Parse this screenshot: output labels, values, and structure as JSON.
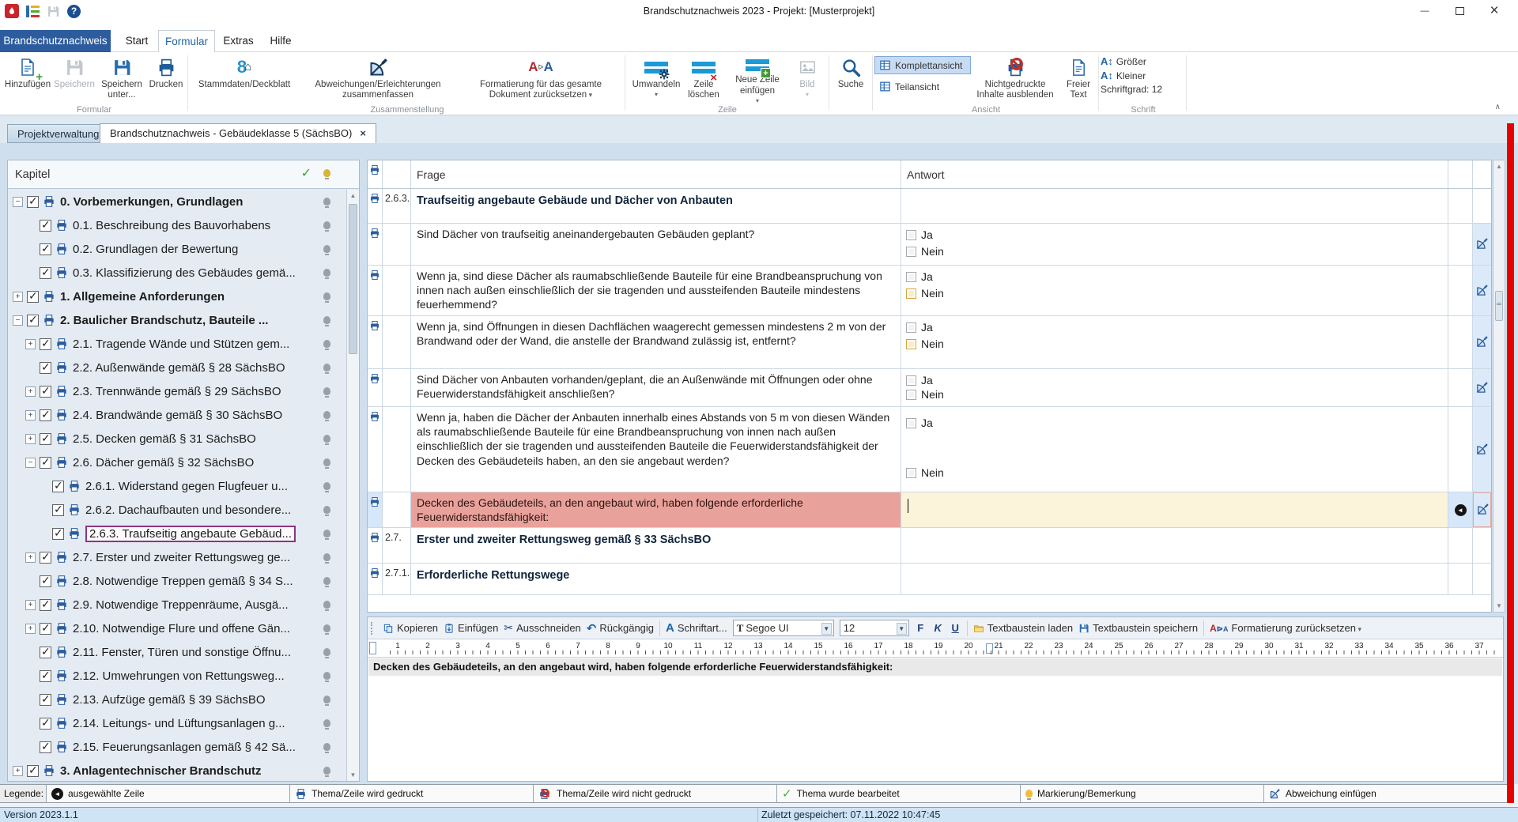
{
  "titlebar": {
    "title": "Brandschutznachweis 2023 - Projekt: [Musterprojekt]"
  },
  "menu": {
    "app_button": "Brandschutznachweis",
    "tabs": [
      "Start",
      "Formular",
      "Extras",
      "Hilfe"
    ],
    "active_tab": "Formular"
  },
  "ribbon": {
    "formular": {
      "label": "Formular",
      "add": "Hinzufügen",
      "save": "Speichern",
      "save_as": "Speichern unter...",
      "print": "Drucken"
    },
    "zusammenstellung": {
      "label": "Zusammenstellung",
      "stammdaten": "Stammdaten/Deckblatt",
      "abweichungen": "Abweichungen/Erleichterungen zusammenfassen",
      "formatierung": "Formatierung für das gesamte Dokument zurücksetzen"
    },
    "zeile": {
      "label": "Zeile",
      "umwandeln": "Umwandeln",
      "zeile_loeschen": "Zeile löschen",
      "neue_zeile": "Neue Zeile einfügen",
      "bild": "Bild"
    },
    "suche": "Suche",
    "ansicht": {
      "label": "Ansicht",
      "komplett": "Komplettansicht",
      "teil": "Teilansicht",
      "nichtgedruckt": "Nichtgedruckte Inhalte ausblenden",
      "freier_text": "Freier Text"
    },
    "schrift": {
      "label": "Schrift",
      "groesser": "Größer",
      "kleiner": "Kleiner",
      "schriftgrad": "Schriftgrad: 12"
    }
  },
  "doc_tabs": {
    "project": "Projektverwaltung",
    "document": "Brandschutznachweis - Gebäudeklasse 5 (SächsBO)"
  },
  "tree": {
    "header": "Kapitel",
    "items": [
      {
        "label": "0. Vorbemerkungen, Grundlagen",
        "level": 0,
        "expander": "minus",
        "bold": true
      },
      {
        "label": "0.1. Beschreibung des Bauvorhabens",
        "level": 1,
        "expander": "none"
      },
      {
        "label": "0.2. Grundlagen der Bewertung",
        "level": 1,
        "expander": "none"
      },
      {
        "label": "0.3. Klassifizierung des Gebäudes gemä...",
        "level": 1,
        "expander": "none"
      },
      {
        "label": "1. Allgemeine Anforderungen",
        "level": 0,
        "expander": "plus",
        "bold": true
      },
      {
        "label": "2. Baulicher Brandschutz, Bauteile ...",
        "level": 0,
        "expander": "minus",
        "bold": true
      },
      {
        "label": "2.1. Tragende Wände und Stützen gem...",
        "level": 1,
        "expander": "plus"
      },
      {
        "label": "2.2. Außenwände gemäß § 28 SächsBO",
        "level": 1,
        "expander": "none"
      },
      {
        "label": "2.3. Trennwände gemäß § 29 SächsBO",
        "level": 1,
        "expander": "plus"
      },
      {
        "label": "2.4. Brandwände gemäß § 30 SächsBO",
        "level": 1,
        "expander": "plus"
      },
      {
        "label": "2.5. Decken gemäß § 31 SächsBO",
        "level": 1,
        "expander": "plus"
      },
      {
        "label": "2.6. Dächer gemäß § 32 SächsBO",
        "level": 1,
        "expander": "minus"
      },
      {
        "label": "2.6.1. Widerstand gegen Flugfeuer u...",
        "level": 2,
        "expander": "none"
      },
      {
        "label": "2.6.2. Dachaufbauten und besondere...",
        "level": 2,
        "expander": "none"
      },
      {
        "label": "2.6.3. Traufseitig angebaute Gebäud...",
        "level": 2,
        "expander": "none",
        "selected": true
      },
      {
        "label": "2.7. Erster und zweiter Rettungsweg ge...",
        "level": 1,
        "expander": "plus"
      },
      {
        "label": "2.8. Notwendige Treppen gemäß § 34 S...",
        "level": 1,
        "expander": "none"
      },
      {
        "label": "2.9. Notwendige Treppenräume, Ausgä...",
        "level": 1,
        "expander": "plus"
      },
      {
        "label": "2.10. Notwendige Flure und offene Gän...",
        "level": 1,
        "expander": "plus"
      },
      {
        "label": "2.11. Fenster, Türen und sonstige Öffnu...",
        "level": 1,
        "expander": "none"
      },
      {
        "label": "2.12. Umwehrungen von Rettungsweg...",
        "level": 1,
        "expander": "none"
      },
      {
        "label": "2.13. Aufzüge gemäß § 39 SächsBO",
        "level": 1,
        "expander": "none"
      },
      {
        "label": "2.14. Leitungs- und Lüftungsanlagen g...",
        "level": 1,
        "expander": "none"
      },
      {
        "label": "2.15. Feuerungsanlagen gemäß § 42 Sä...",
        "level": 1,
        "expander": "none"
      },
      {
        "label": "3. Anlagentechnischer Brandschutz",
        "level": 0,
        "expander": "plus",
        "bold": true
      }
    ]
  },
  "table": {
    "header_frage": "Frage",
    "header_antwort": "Antwort",
    "ja_label": "Ja",
    "nein_label": "Nein",
    "rows": [
      {
        "type": "chapter",
        "num": "2.6.3.",
        "text": "Traufseitig angebaute Gebäude und Dächer von Anbauten"
      },
      {
        "type": "question",
        "text": "Sind Dächer von traufseitig aneinandergebauten Gebäuden geplant?",
        "nein_state": "normal"
      },
      {
        "type": "question",
        "text": "Wenn ja, sind diese Dächer als raumabschließende Bauteile für eine Brandbeanspruchung von innen nach außen einschließlich der sie tragenden und aussteifenden Bauteile mindestens feuerhemmend?",
        "nein_state": "highlighted"
      },
      {
        "type": "question",
        "text": "Wenn ja, sind Öffnungen in diesen Dachflächen waagerecht gemessen mindestens 2 m von der Brandwand oder der Wand, die anstelle der Brandwand zulässig ist, entfernt?",
        "nein_state": "highlighted"
      },
      {
        "type": "question",
        "text": "Sind Dächer von Anbauten vorhanden/geplant, die an Außenwände mit Öffnungen oder ohne Feuerwiderstandsfähigkeit anschließen?",
        "nein_state": "normal"
      },
      {
        "type": "question",
        "text": "Wenn ja, haben die Dächer der Anbauten innerhalb eines Abstands von 5 m von diesen Wänden als raumabschließende Bauteile für eine Brandbeanspruchung von innen nach außen einschließlich der sie tragenden und aussteifenden Bauteile die Feuerwiderstandsfähigkeit der Decken des Gebäudeteils haben, an den sie angebaut werden?",
        "nein_state": "normal"
      },
      {
        "type": "input",
        "text": "Decken des Gebäudeteils, an den angebaut wird, haben folgende erforderliche Feuerwiderstandsfähigkeit:",
        "answer": "",
        "selected": true
      },
      {
        "type": "chapter",
        "num": "2.7.",
        "text": "Erster und zweiter Rettungsweg gemäß § 33 SächsBO"
      },
      {
        "type": "chapter",
        "num": "2.7.1.",
        "text": "Erforderliche Rettungswege"
      }
    ]
  },
  "editor": {
    "kopieren": "Kopieren",
    "einfuegen": "Einfügen",
    "ausschneiden": "Ausschneiden",
    "rueckgaengig": "Rückgängig",
    "schriftart": "Schriftart...",
    "font_name": "Segoe UI",
    "font_size": "12",
    "bold": "F",
    "italic": "K",
    "underline": "U",
    "tb_laden": "Textbaustein laden",
    "tb_speichern": "Textbaustein speichern",
    "format_reset": "Formatierung zurücksetzen",
    "ruler_max": 37,
    "text": "Decken des Gebäudeteils, an den angebaut wird, haben folgende erforderliche Feuerwiderstandsfähigkeit:"
  },
  "legend": {
    "label": "Legende:",
    "items": [
      {
        "label": "ausgewählte Zeile",
        "icon": "selected-row-marker"
      },
      {
        "label": "Thema/Zeile wird gedruckt",
        "icon": "printer"
      },
      {
        "label": "Thema/Zeile wird nicht gedruckt",
        "icon": "printer-blocked"
      },
      {
        "label": "Thema wurde bearbeitet",
        "icon": "green-check"
      },
      {
        "label": "Markierung/Bemerkung",
        "icon": "bulb"
      },
      {
        "label": "Abweichung einfügen",
        "icon": "protractor"
      }
    ]
  },
  "statusbar": {
    "version": "Version 2023.1.1",
    "saved": "Zuletzt gespeichert: 07.11.2022 10:47:45"
  },
  "colors": {
    "accent_blue": "#2d5c9e",
    "selected_row_pink": "#e9a29b",
    "answer_cream": "#fbf3da",
    "warn_checkbox": "#d9a43b",
    "red_stripe": "#e60000"
  }
}
